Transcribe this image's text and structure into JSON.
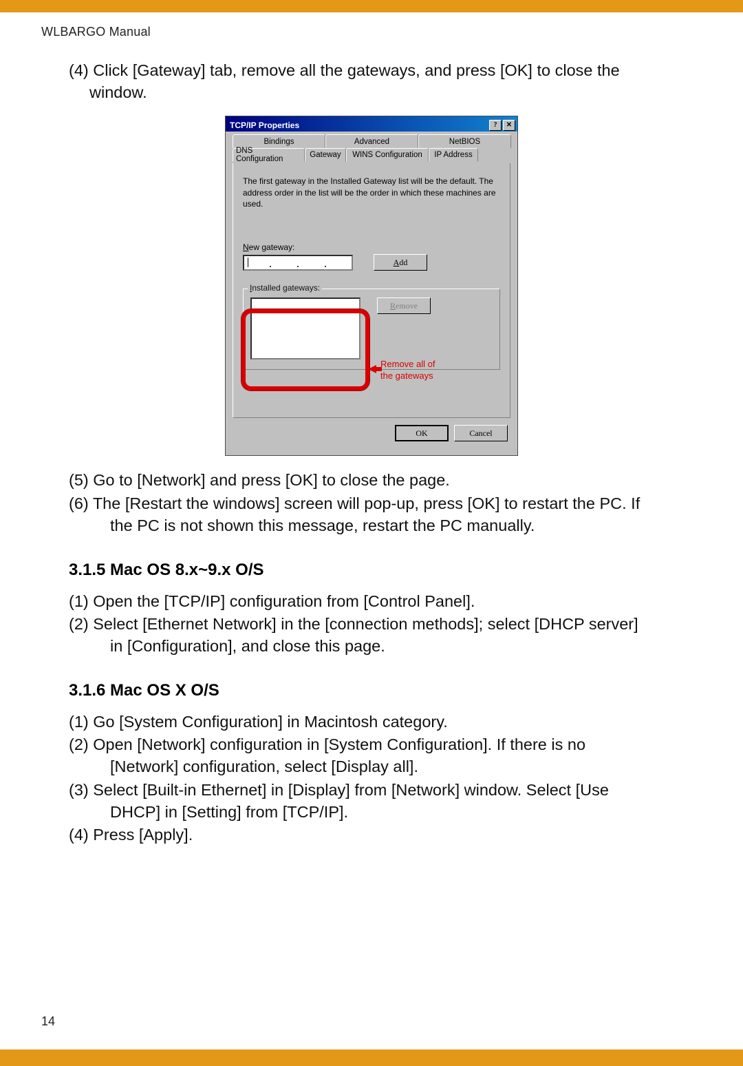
{
  "doc": {
    "header": "WLBARGO Manual",
    "page_number": "14"
  },
  "steps_top": {
    "s4": "(4) Click [Gateway] tab, remove all the gateways, and press [OK] to close the window."
  },
  "steps_mid": {
    "s5": "(5) Go to [Network] and press [OK] to close the page.",
    "s6a": "(6) The [Restart the windows] screen will pop-up, press [OK] to restart the PC. If",
    "s6b": "the PC is not shown this message, restart the PC manually."
  },
  "section_315": {
    "heading": "3.1.5 Mac OS 8.x~9.x O/S",
    "s1": "(1) Open the [TCP/IP] configuration from [Control Panel].",
    "s2a": "(2) Select [Ethernet Network] in the [connection methods]; select [DHCP server]",
    "s2b": "in [Configuration], and close this page."
  },
  "section_316": {
    "heading": "3.1.6 Mac OS X O/S",
    "s1": "(1) Go [System Configuration] in Macintosh category.",
    "s2a": "(2) Open [Network] configuration in [System Configuration]. If there is no",
    "s2b": "[Network] configuration, select [Display all].",
    "s3a": "(3) Select [Built-in Ethernet] in [Display] from [Network] window. Select [Use",
    "s3b": "DHCP] in [Setting] from [TCP/IP].",
    "s4": "(4) Press [Apply]."
  },
  "dialog": {
    "title": "TCP/IP Properties",
    "help_glyph": "?",
    "close_glyph": "✕",
    "tabs_back": {
      "bindings": "Bindings",
      "advanced": "Advanced",
      "netbios": "NetBIOS"
    },
    "tabs_front": {
      "dns": "DNS Configuration",
      "gateway": "Gateway",
      "wins": "WINS Configuration",
      "ip": "IP Address"
    },
    "desc": "The first gateway in the Installed Gateway list will be the default. The address order in the list will be the order in which these machines are used.",
    "labels": {
      "new_gateway_pre": "N",
      "new_gateway_rest": "ew gateway:",
      "installed_pre": "I",
      "installed_rest": "nstalled gateways:"
    },
    "buttons": {
      "add_pre": "A",
      "add_rest": "dd",
      "remove_pre": "R",
      "remove_rest": "emove",
      "ok": "OK",
      "cancel": "Cancel"
    },
    "annotation": {
      "line1": "Remove all of",
      "line2": "the gateways"
    }
  }
}
